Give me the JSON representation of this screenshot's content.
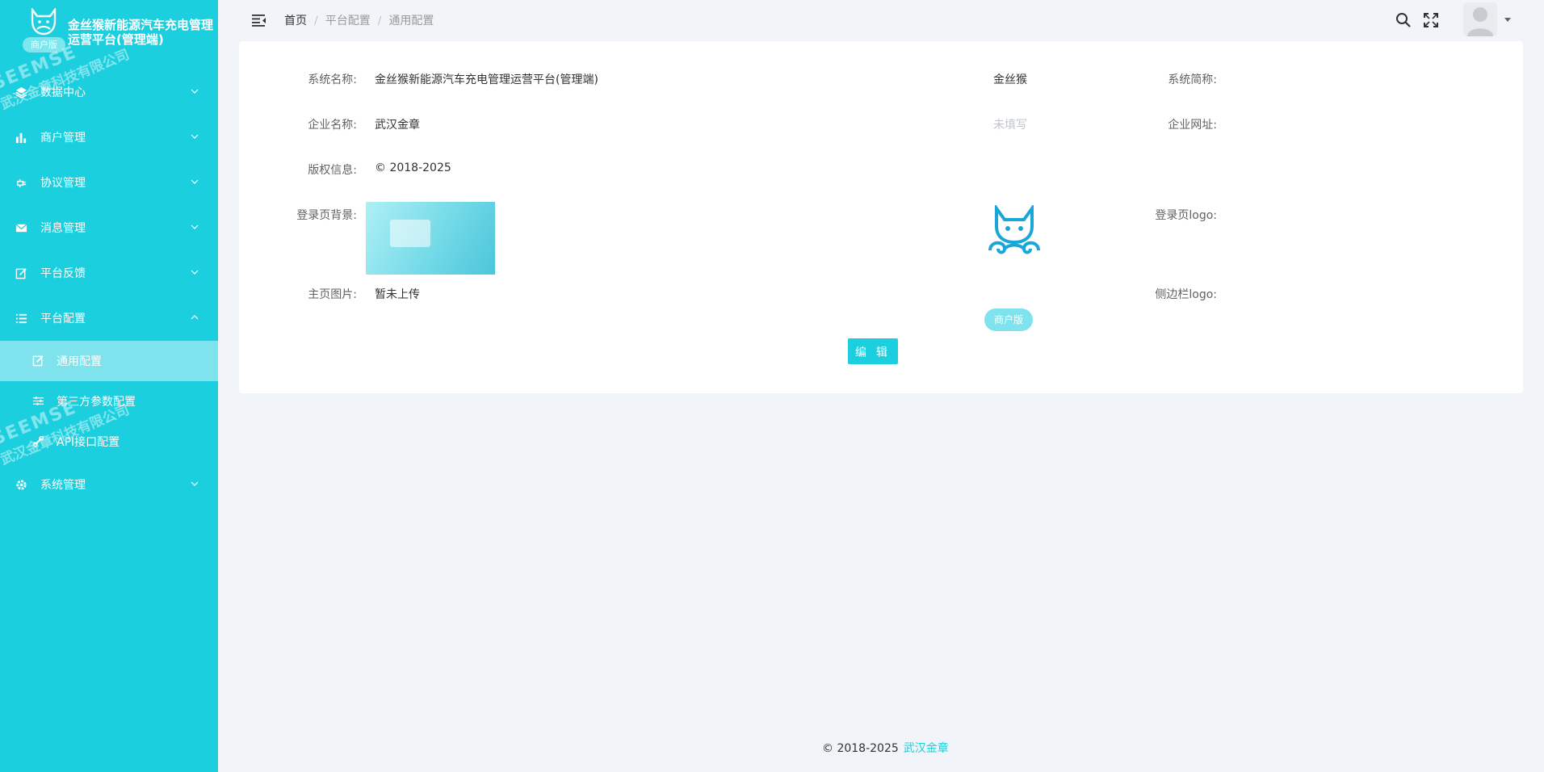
{
  "brand": {
    "title": "金丝猴新能源汽车充电管理运营平台(管理端)",
    "badge": "商户版"
  },
  "sidebar": {
    "items": [
      {
        "label": "数据中心",
        "icon": "layers-icon",
        "expanded": false
      },
      {
        "label": "商户管理",
        "icon": "bar-chart-icon",
        "expanded": false
      },
      {
        "label": "协议管理",
        "icon": "plug-icon",
        "expanded": false
      },
      {
        "label": "消息管理",
        "icon": "mail-icon",
        "expanded": false
      },
      {
        "label": "平台反馈",
        "icon": "edit-icon",
        "expanded": false
      },
      {
        "label": "平台配置",
        "icon": "list-icon",
        "expanded": true,
        "children": [
          {
            "label": "通用配置",
            "icon": "edit-icon",
            "active": true
          },
          {
            "label": "第三方参数配置",
            "icon": "sliders-icon",
            "active": false
          },
          {
            "label": "API接口配置",
            "icon": "api-icon",
            "active": false
          }
        ]
      },
      {
        "label": "系统管理",
        "icon": "gear-icon",
        "expanded": false
      }
    ]
  },
  "watermark": {
    "brand": "SEEMSE",
    "company": "武汉金章科技有限公司"
  },
  "header": {
    "breadcrumb": [
      "首页",
      "平台配置",
      "通用配置"
    ],
    "separator": "/"
  },
  "config": {
    "system_name": {
      "label": "系统名称:",
      "value": "金丝猴新能源汽车充电管理运营平台(管理端)"
    },
    "system_short": {
      "label": "系统简称:",
      "value": "金丝猴"
    },
    "company_name": {
      "label": "企业名称:",
      "value": "武汉金章"
    },
    "company_url": {
      "label": "企业网址:",
      "value": "未填写"
    },
    "copyright": {
      "label": "版权信息:",
      "value": "© 2018-2025"
    },
    "login_bg": {
      "label": "登录页背景:"
    },
    "login_logo": {
      "label": "登录页logo:"
    },
    "home_image": {
      "label": "主页图片:",
      "value": "暂未上传"
    },
    "sidebar_logo": {
      "label": "侧边栏logo:",
      "badge": "商户版"
    },
    "edit_label": "编 辑"
  },
  "footer": {
    "copyright": "© 2018-2025",
    "company": "武汉金章"
  },
  "colors": {
    "primary": "#1ccfdf",
    "active_item": "#7fe3ed",
    "background": "#f1f5f9"
  }
}
